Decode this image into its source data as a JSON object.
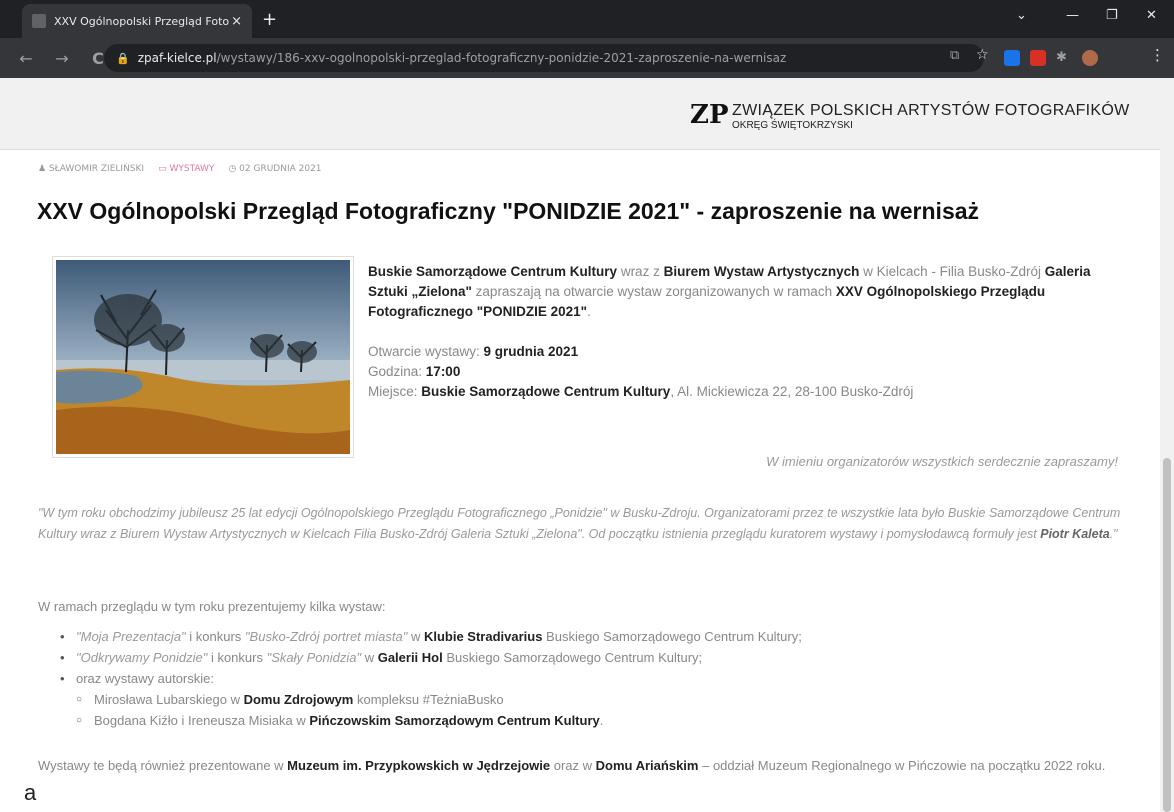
{
  "browser": {
    "tab_title": "XXV Ogólnopolski Przegląd Foto",
    "tab_close": "×",
    "new_tab": "+",
    "url_domain": "zpaf-kielce.pl",
    "url_path": "/wystawy/186-xxv-ogolnopolski-przeglad-fotograficzny-ponidzie-2021-zaproszenie-na-wernisaz",
    "minimize": "—",
    "restore": "❐",
    "close": "✕",
    "back": "←",
    "forward": "→",
    "reload": "C",
    "menu": "⋮"
  },
  "site": {
    "org_name": "ZWIĄZEK POLSKICH ARTYSTÓW FOTOGRAFIKÓW",
    "org_sub": "OKRĘG ŚWIĘTOKRZYSKI",
    "logo_mark": "ZP"
  },
  "article": {
    "author": "SŁAWOMIR ZIELIŃSKI",
    "category": "WYSTAWY",
    "date": "02 GRUDNIA 2021",
    "title": "XXV Ogólnopolski Przegląd Fotograficzny \"PONIDZIE 2021\" - zaproszenie na wernisaż",
    "intro": {
      "org1": "Buskie Samorządowe Centrum Kultury",
      "t1": " wraz z ",
      "org2": "Biurem Wystaw Artystycznych",
      "t2": " w Kielcach - Filia Busko-Zdrój ",
      "gallery": "Galeria Sztuki „Zielona\"",
      "t3": " zapraszają na otwarcie wystaw zorganizowanych w ramach ",
      "event": "XXV Ogólnopolskiego Przeglądu Fotograficznego \"PONIDZIE 2021\"",
      "t4": "."
    },
    "opening_label": "Otwarcie wystawy: ",
    "opening_value": "9 grudnia 2021",
    "time_label": "Godzina: ",
    "time_value": "17:00",
    "place_label": "Miejsce: ",
    "place_value": "Buskie Samorządowe Centrum Kultury",
    "place_address": ", Al. Mickiewicza 22, 28-100 Busko-Zdrój",
    "invite": "W imieniu organizatorów wszystkich serdecznie zapraszamy!",
    "quote_text": "\"W tym roku obchodzimy jubileusz 25 lat edycji Ogólnopolskiego Przeglądu Fotograficznego „Ponidzie\" w Busku-Zdroju. Organizatorami przez te wszystkie lata było Buskie Samorządowe Centrum Kultury wraz z Biurem Wystaw Artystycznych w Kielcach Filia Busko-Zdrój Galeria Sztuki „Zielona\". Od początku istnienia przeglądu kuratorem wystawy i pomysłodawcą formuły jest ",
    "quote_name": "Piotr Kaleta",
    "quote_end": ".\"",
    "list_intro": "W ramach przeglądu w tym roku prezentujemy kilka wystaw:",
    "items": [
      {
        "i1": "\"Moja Prezentacja\"",
        "t1": " i konkurs ",
        "i2": "\"Busko-Zdrój portret miasta\"",
        "t2": " w ",
        "b": "Klubie Stradivarius",
        "t3": " Buskiego Samorządowego Centrum Kultury;"
      },
      {
        "i1": "\"Odkrywamy Ponidzie\"",
        "t1": " i konkurs ",
        "i2": "\"Skały Ponidzia\"",
        "t2": " w ",
        "b": "Galerii Hol",
        "t3": " Buskiego Samorządowego Centrum Kultury;"
      }
    ],
    "item3": "oraz wystawy autorskie:",
    "sub1": {
      "t1": "Mirosława Lubarskiego w ",
      "b": "Domu Zdrojowym",
      "t2": " kompleksu #TeżniaBusko"
    },
    "sub2": {
      "t1": "Bogdana Kiźło i Ireneusza Misiaka w ",
      "b": "Pińczowskim Samorządowym Centrum Kultury",
      "t2": "."
    },
    "closing": {
      "t1": "Wystawy te będą również prezentowane w ",
      "b1": "Muzeum im. Przypkowskich w Jędrzejowie",
      "t2": " oraz w ",
      "b2": "Domu Ariańskim",
      "t3": " – oddział Muzeum Regionalnego w Pińczowie na początku 2022 roku."
    }
  },
  "corner_label": "a",
  "colors": {
    "tabbar": "#202124",
    "toolbar": "#35363a",
    "category": "#e07a9a"
  }
}
